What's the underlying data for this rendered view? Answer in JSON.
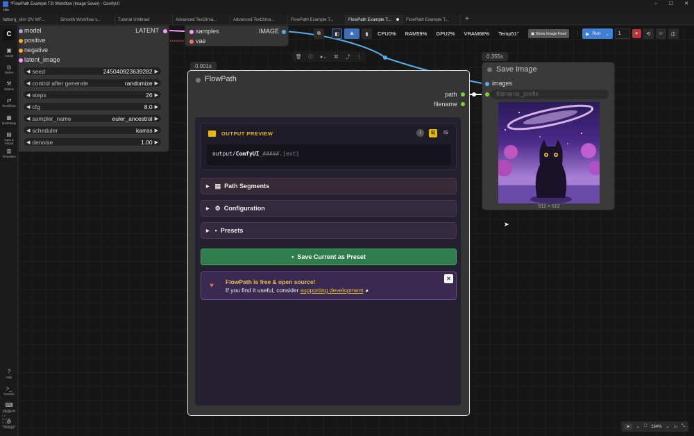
{
  "window": {
    "title": "*FlowPath Example T2I Workflow (Image Saver) - ComfyUI",
    "menu": "Idle"
  },
  "tabs": [
    {
      "label": "fatberg_slim I2V WF..."
    },
    {
      "label": "Smooth Workflow v..."
    },
    {
      "label": "Tutorial Umbrael"
    },
    {
      "label": "Advanced Text2Ima..."
    },
    {
      "label": "Advanced Text2Ima..."
    },
    {
      "label": "FlowPath Example T..."
    },
    {
      "label": "FlowPath Example T...",
      "active": true
    },
    {
      "label": "FlowPath Example T..."
    }
  ],
  "sidebar": {
    "items": [
      {
        "label": "Assets",
        "icon": "assets-icon"
      },
      {
        "label": "Nodes",
        "icon": "nodes-icon"
      },
      {
        "label": "Models",
        "icon": "models-icon"
      },
      {
        "label": "Workflows",
        "icon": "workflows-icon"
      },
      {
        "label": "NodesMap",
        "icon": "map-icon"
      },
      {
        "label": "Input & Output",
        "icon": "io-icon"
      },
      {
        "label": "Templates",
        "icon": "templates-icon"
      }
    ],
    "bottom": [
      {
        "label": "Help",
        "icon": "help-icon"
      },
      {
        "label": "Console",
        "icon": "console-icon"
      },
      {
        "label": "Shortcuts",
        "icon": "shortcuts-icon"
      },
      {
        "label": "Settings",
        "icon": "settings-icon"
      }
    ],
    "stats": [
      "T: 0.00s",
      "I: 0",
      "N: 8 [8]",
      "V: 16",
      "FPS:172.57"
    ]
  },
  "toolbar": {
    "cpu": "CPU0%",
    "ram": "RAM59%",
    "gpu": "GPU2%",
    "vram": "VRAM68%",
    "temp": "Temp51°",
    "feed_label": "Show Image Feed",
    "run_label": "Run",
    "queue_count": "1"
  },
  "ksampler": {
    "inputs": [
      "model",
      "positive",
      "negative",
      "latent_image"
    ],
    "output": "LATENT",
    "widgets": [
      {
        "label": "seed",
        "value": "245040923639282"
      },
      {
        "label": "control after generate",
        "value": "randomize"
      },
      {
        "label": "steps",
        "value": "26"
      },
      {
        "label": "cfg",
        "value": "8.0"
      },
      {
        "label": "sampler_name",
        "value": "euler_ancestral"
      },
      {
        "label": "scheduler",
        "value": "karras"
      },
      {
        "label": "denoise",
        "value": "1.00"
      }
    ]
  },
  "vae_decode": {
    "inputs": [
      "samples",
      "vae"
    ],
    "output": "IMAGE"
  },
  "flowpath": {
    "badge": "0.001s",
    "title": "FlowPath",
    "outputs": [
      "path",
      "filename"
    ],
    "preview_title": "OUTPUT PREVIEW",
    "preview_tag": "$|",
    "preview_tag2": "IS",
    "preview_prefix": "output/",
    "preview_bold": "ComfyUI",
    "preview_suffix": "_#####.[ext]",
    "sections": [
      "Path Segments",
      "Configuration",
      "Presets"
    ],
    "save_preset": "Save Current as Preset",
    "donate_title": "FlowPath is free & open source!",
    "donate_text": "If you find it useful, consider",
    "donate_link": "supporting development"
  },
  "save_image": {
    "badge": "0.355s",
    "title": "Save Image",
    "input": "images",
    "prefix_placeholder": "filename_prefix",
    "dims": "512 × 512"
  },
  "zoom": {
    "level": "164%"
  },
  "colors": {
    "accent": "#3f7fd5",
    "link_blue": "#5aaee8",
    "latent_pink": "#ff9cf9",
    "green_socket": "#7bd13b",
    "preview_gold": "#e6b800"
  }
}
